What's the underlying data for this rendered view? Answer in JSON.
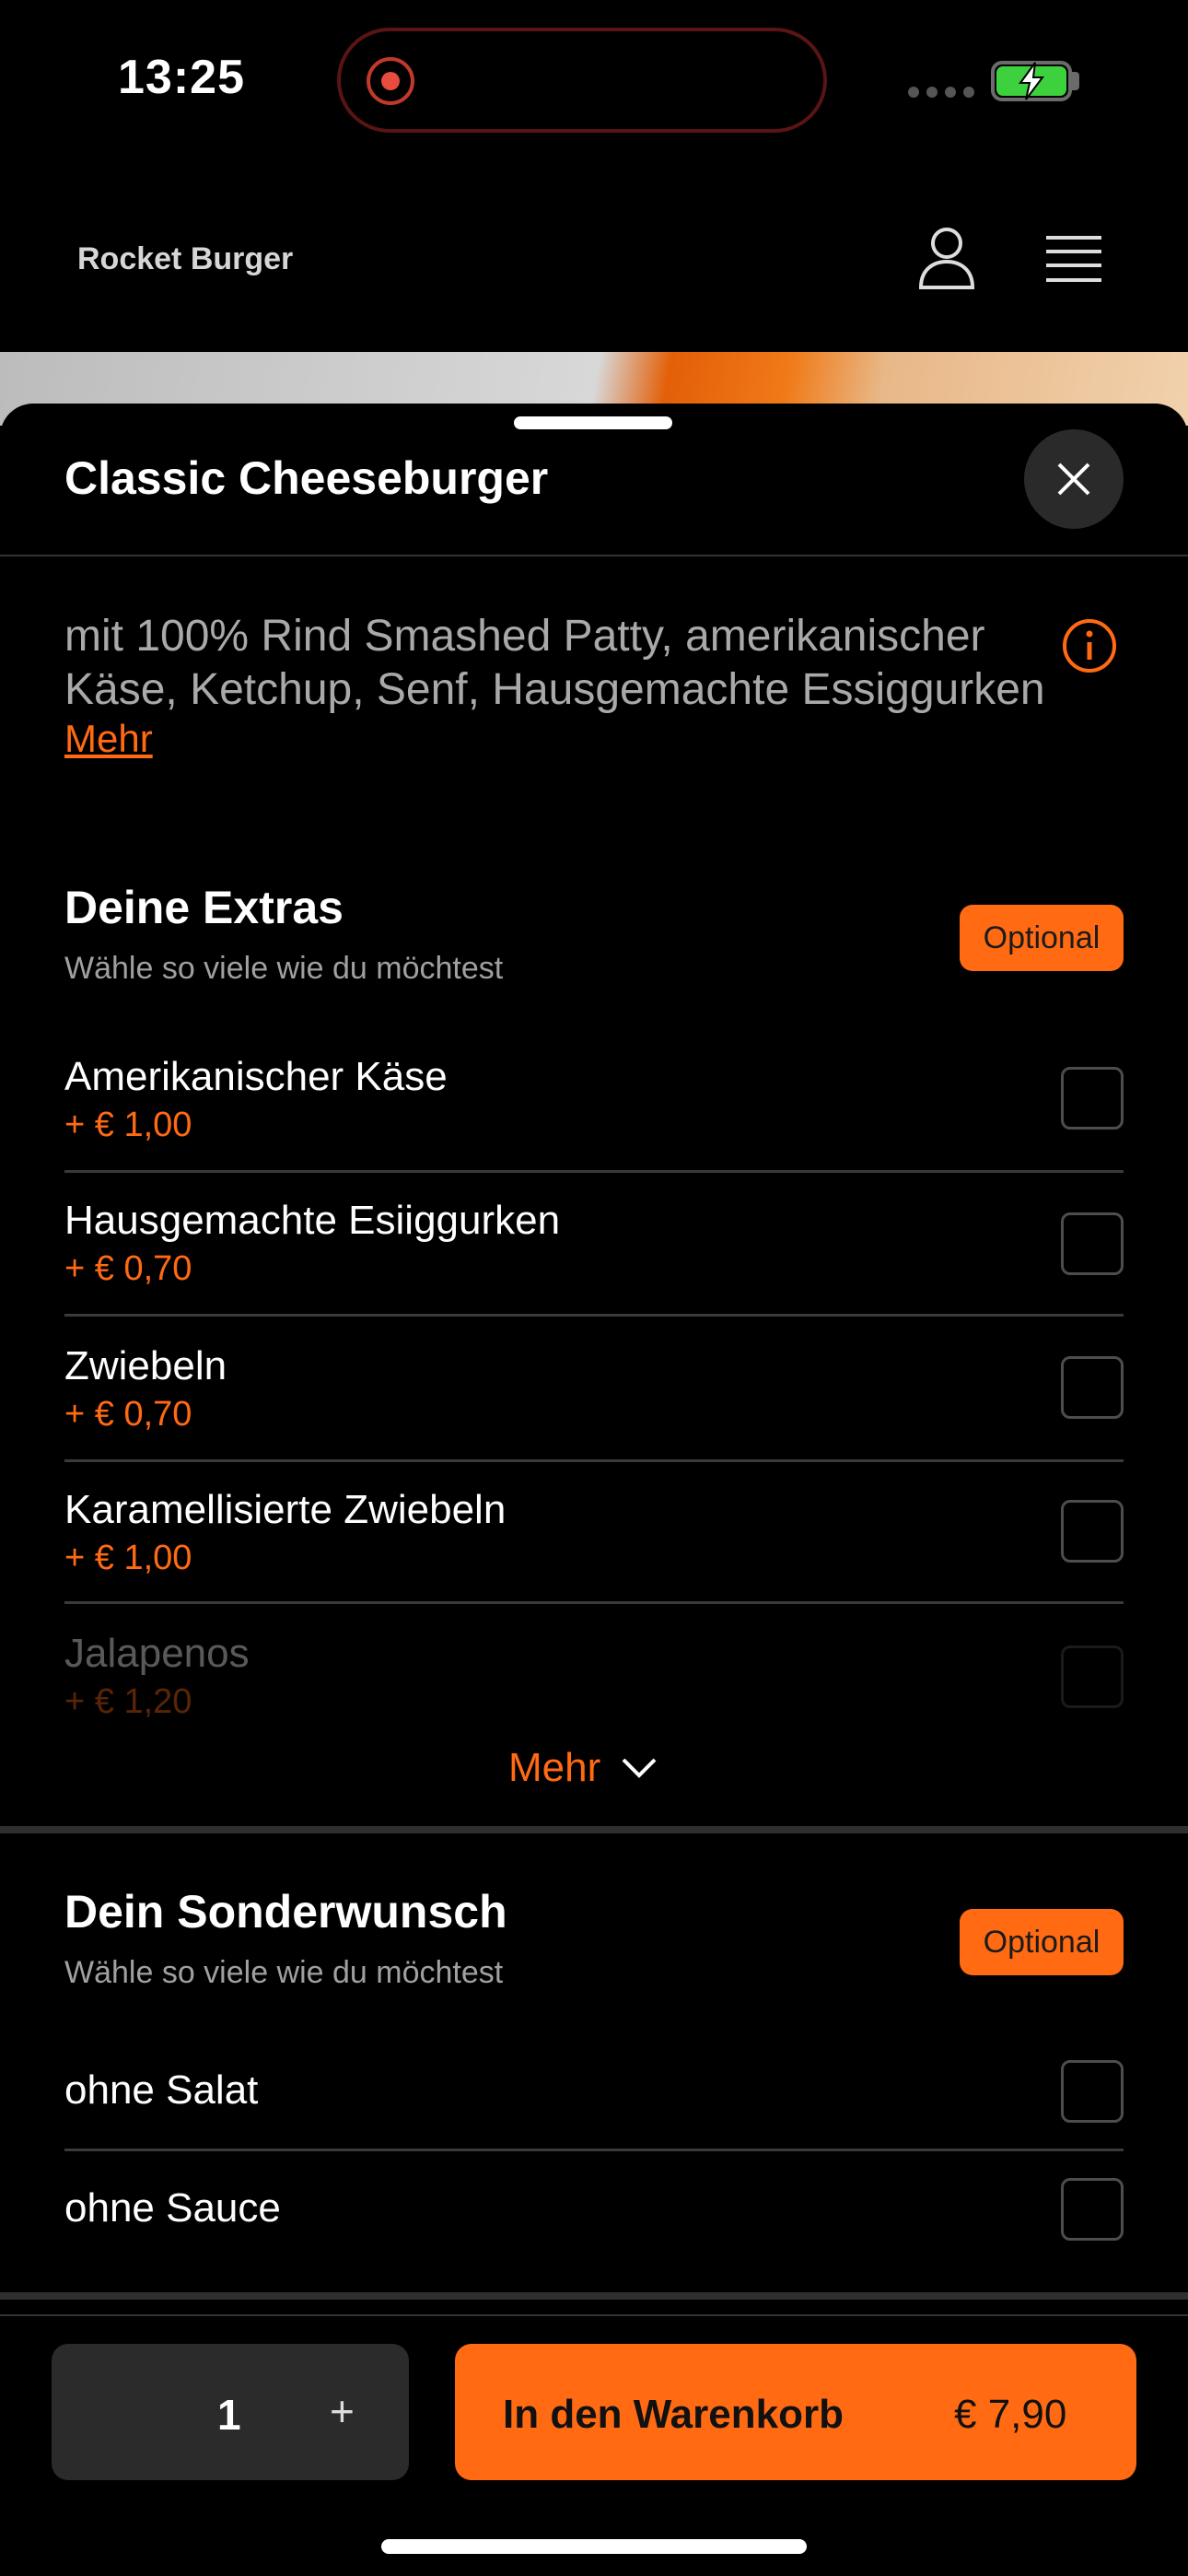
{
  "status_bar": {
    "time": "13:25",
    "battery_color": "#3dd13d"
  },
  "header": {
    "brand": "Rocket Burger",
    "icons": [
      "user-icon",
      "menu-icon"
    ]
  },
  "product": {
    "title": "Classic Cheeseburger",
    "desc_line1": "mit 100% Rind Smashed Patty, amerikanischer",
    "desc_line2": "Käse, Ketchup, Senf, Hausgemachte Essiggurken",
    "more_label": "Mehr"
  },
  "extras": {
    "title": "Deine Extras",
    "subtitle": "Wähle so viele wie du möchtest",
    "badge": "Optional",
    "items": [
      {
        "name": "Amerikanischer Käse",
        "price": "+ € 1,00"
      },
      {
        "name": "Hausgemachte Esiiggurken",
        "price": "+ € 0,70"
      },
      {
        "name": "Zwiebeln",
        "price": "+ € 0,70"
      },
      {
        "name": "Karamellisierte Zwiebeln",
        "price": "+ € 1,00"
      },
      {
        "name": "Jalapenos",
        "price": "+ € 1,20"
      }
    ],
    "more_label": "Mehr"
  },
  "special": {
    "title": "Dein Sonderwunsch",
    "subtitle": "Wähle so viele wie du möchtest",
    "badge": "Optional",
    "items": [
      {
        "name": "ohne Salat"
      },
      {
        "name": "ohne Sauce"
      }
    ]
  },
  "footer": {
    "quantity": "1",
    "plus": "+",
    "cart_label": "In den Warenkorb",
    "cart_price": "€ 7,90"
  },
  "colors": {
    "accent": "#ff6a13",
    "background": "#000000"
  }
}
